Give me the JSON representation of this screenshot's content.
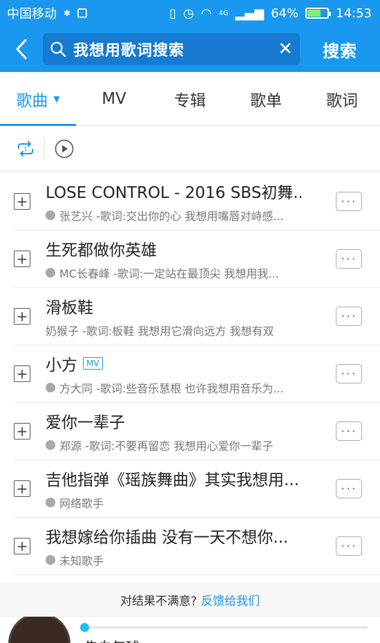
{
  "status": {
    "carrier": "中国移动",
    "network": "4G",
    "battery": "64%",
    "time": "14:53"
  },
  "search": {
    "query": "我想用歌词搜索",
    "button": "搜索"
  },
  "tabs": [
    {
      "label": "歌曲"
    },
    {
      "label": "MV"
    },
    {
      "label": "专辑"
    },
    {
      "label": "歌单"
    },
    {
      "label": "歌词"
    }
  ],
  "results": [
    {
      "title": "LOSE CONTROL - 2016 SBS初舞...",
      "subtitle": "张艺兴 -歌词:交出你的心 我想用嘴唇对峙感...",
      "mv": ""
    },
    {
      "title": "生死都做你英雄",
      "subtitle": "MC长春峰 -歌词:一定站在最顶尖 我想用我...",
      "mv": ""
    },
    {
      "title": "滑板鞋",
      "subtitle": "奶猴子 -歌词:板鞋 我想用它滑向远方 我想有双",
      "mv": ""
    },
    {
      "title": "小方",
      "subtitle": "方大同 -歌词:些音乐慧根 也许我想用音乐为...",
      "mv": "MV"
    },
    {
      "title": "爱你一辈子",
      "subtitle": "郑源 -歌词:不要再留恋 我想用心爱你一辈子",
      "mv": ""
    },
    {
      "title": "吉他指弹《瑶族舞曲》其实我想用...",
      "subtitle": "网络歌手",
      "mv": ""
    },
    {
      "title": "我想嫁给你插曲 没有一天不想你...",
      "subtitle": "未知歌手",
      "mv": ""
    }
  ],
  "more_label": "···",
  "footer": {
    "text": "对结果不满意?",
    "link": "反馈给我们"
  },
  "player": {
    "title": "告白气球",
    "progress": 0
  },
  "colors": {
    "brand": "#1a98f0",
    "search_bg": "#157ad0"
  }
}
